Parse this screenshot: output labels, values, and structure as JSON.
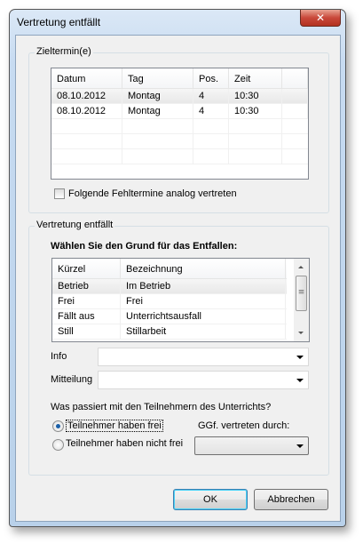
{
  "window": {
    "title": "Vertretung entfällt",
    "close_icon": "close-icon"
  },
  "group1": {
    "label": "Zieltermin(e)",
    "columns": [
      "Datum",
      "Tag",
      "Pos.",
      "Zeit"
    ],
    "rows": [
      [
        "08.10.2012",
        "Montag",
        "4",
        "10:30"
      ],
      [
        "08.10.2012",
        "Montag",
        "4",
        "10:30"
      ]
    ],
    "checkbox_label": "Folgende Fehltermine analog vertreten",
    "checkbox_checked": false
  },
  "group2": {
    "label": "Vertretung entfällt",
    "prompt": "Wählen Sie den Grund für das Entfallen:",
    "columns": [
      "Kürzel",
      "Bezeichnung"
    ],
    "rows": [
      [
        "Betrieb",
        "Im Betrieb"
      ],
      [
        "Frei",
        "Frei"
      ],
      [
        "Fällt aus",
        "Unterrichtsausfall"
      ],
      [
        "Still",
        "Stillarbeit"
      ]
    ],
    "info_label": "Info",
    "info_value": "",
    "mitteilung_label": "Mitteilung",
    "mitteilung_value": "",
    "question": "Was passiert mit den Teilnehmern des Unterrichts?",
    "radio1": "Teilnehmer haben frei",
    "radio2": "Teilnehmer haben nicht frei",
    "selected_radio": "radio1",
    "vertreten_label": "GGf. vertreten durch:",
    "vertreten_value": ""
  },
  "buttons": {
    "ok": "OK",
    "cancel": "Abbrechen"
  }
}
